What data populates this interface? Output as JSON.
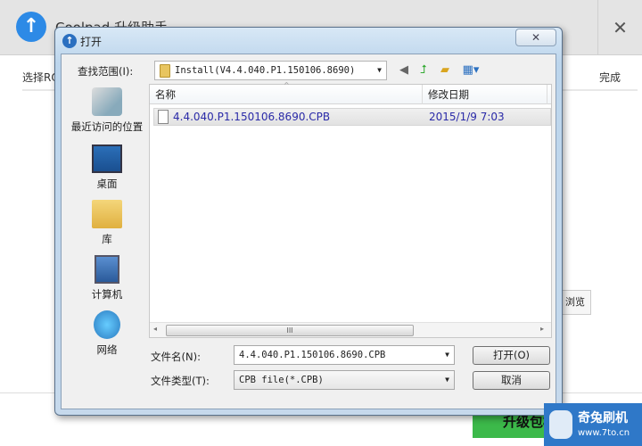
{
  "app": {
    "title": "Coolpad 升级助手",
    "close": "✕",
    "steps": {
      "first": "选择ROM",
      "last": "完成"
    },
    "browse_label": "浏览",
    "upgrade_label": "升级包检"
  },
  "dialog": {
    "title": "打开",
    "close": "✕",
    "lookin_label": "查找范围(I):",
    "lookin_value": "Install(V4.4.040.P1.150106.8690)",
    "places": [
      "最近访问的位置",
      "桌面",
      "库",
      "计算机",
      "网络"
    ],
    "columns": [
      "名称",
      "修改日期"
    ],
    "files": [
      {
        "name": "4.4.040.P1.150106.8690.CPB",
        "modified": "2015/1/9 7:03"
      }
    ],
    "scroll_grip": "III",
    "filename_label": "文件名(N):",
    "filename_value": "4.4.040.P1.150106.8690.CPB",
    "filetype_label": "文件类型(T):",
    "filetype_value": "CPB file(*.CPB)",
    "open_button": "打开(O)",
    "cancel_button": "取消"
  },
  "watermark": {
    "brand": "奇兔刷机",
    "url": "www.7to.cn"
  }
}
